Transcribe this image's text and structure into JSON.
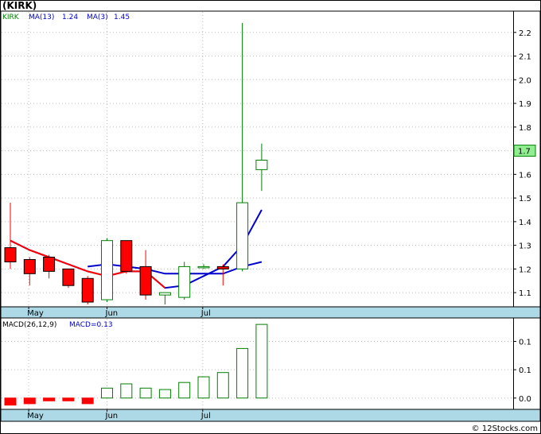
{
  "chart_data": [
    {
      "type": "candlestick",
      "title": "(KIRK)",
      "legend": [
        {
          "label": "KIRK",
          "color": "#008000"
        },
        {
          "label": "MA(13)",
          "color": "#0000cc"
        },
        {
          "label": "1.24",
          "color": "#0000cc"
        },
        {
          "label": "MA(3)",
          "color": "#0000cc"
        },
        {
          "label": "1.45",
          "color": "#0000cc"
        }
      ],
      "x_labels": [
        {
          "label": "May",
          "index": 0.95
        },
        {
          "label": "Jun",
          "index": 5.0
        },
        {
          "label": "Jul",
          "index": 9.95
        }
      ],
      "y_ticks": [
        "1.1",
        "1.2",
        "1.3",
        "1.4",
        "1.5",
        "1.6",
        "1.7",
        "1.8",
        "1.9",
        "2.0",
        "2.1",
        "2.2"
      ],
      "ylim": [
        1.04,
        2.29
      ],
      "last_price": "1.7",
      "up_color": "#008000",
      "down_color": "#ff0000",
      "candles": [
        {
          "o": 1.29,
          "h": 1.48,
          "l": 1.2,
          "c": 1.23
        },
        {
          "o": 1.24,
          "h": 1.25,
          "l": 1.13,
          "c": 1.18
        },
        {
          "o": 1.25,
          "h": 1.26,
          "l": 1.16,
          "c": 1.19
        },
        {
          "o": 1.2,
          "h": 1.2,
          "l": 1.12,
          "c": 1.13
        },
        {
          "o": 1.16,
          "h": 1.17,
          "l": 1.05,
          "c": 1.06
        },
        {
          "o": 1.07,
          "h": 1.33,
          "l": 1.06,
          "c": 1.32
        },
        {
          "o": 1.32,
          "h": 1.32,
          "l": 1.18,
          "c": 1.19
        },
        {
          "o": 1.21,
          "h": 1.28,
          "l": 1.07,
          "c": 1.09
        },
        {
          "o": 1.09,
          "h": 1.1,
          "l": 1.05,
          "c": 1.1
        },
        {
          "o": 1.08,
          "h": 1.23,
          "l": 1.07,
          "c": 1.21
        },
        {
          "o": 1.21,
          "h": 1.22,
          "l": 1.2,
          "c": 1.21
        },
        {
          "o": 1.21,
          "h": 1.22,
          "l": 1.13,
          "c": 1.2
        },
        {
          "o": 1.2,
          "h": 2.24,
          "l": 1.19,
          "c": 1.48
        },
        {
          "o": 1.62,
          "h": 1.73,
          "l": 1.53,
          "c": 1.66
        }
      ],
      "ma13": [
        null,
        null,
        null,
        null,
        1.21,
        1.22,
        1.21,
        1.2,
        1.18,
        1.18,
        1.18,
        1.18,
        1.21,
        1.23
      ],
      "ma3": [
        1.32,
        1.28,
        1.25,
        1.22,
        1.19,
        1.17,
        1.19,
        1.19,
        1.12,
        1.13,
        1.17,
        1.21,
        1.3,
        1.45
      ]
    },
    {
      "type": "bar",
      "title": "MACD(26,12,9)",
      "legend": [
        {
          "label": "MACD(26,12,9)",
          "color": "#000000"
        },
        {
          "label": "MACD=0.13",
          "color": "#0000cc"
        }
      ],
      "x_labels": [
        {
          "label": "May",
          "index": 0.95
        },
        {
          "label": "Jun",
          "index": 5.0
        },
        {
          "label": "Jul",
          "index": 9.95
        }
      ],
      "y_ticks": [
        "0.0",
        "0.1",
        "0.1"
      ],
      "ylim": [
        -0.04,
        0.28
      ],
      "values": [
        -0.025,
        -0.02,
        -0.01,
        -0.01,
        -0.02,
        0.035,
        0.05,
        0.035,
        0.03,
        0.055,
        0.075,
        0.09,
        0.175,
        0.26
      ],
      "pos_color": "#008000",
      "neg_color": "#ff0000"
    }
  ],
  "credit": "© 12Stocks.com"
}
